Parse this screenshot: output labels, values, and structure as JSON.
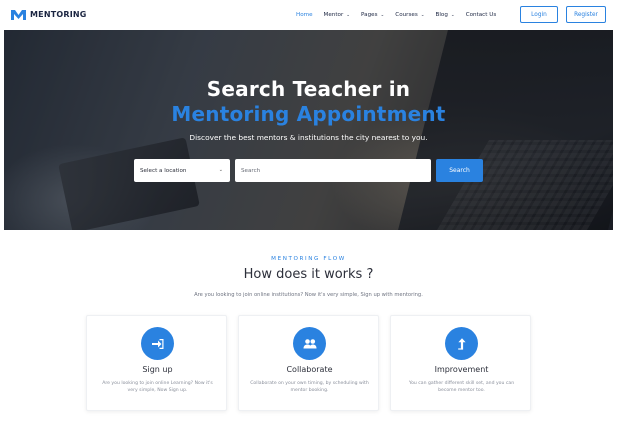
{
  "header": {
    "logo_text": "MENTORING",
    "nav": [
      {
        "label": "Home",
        "active": true,
        "dropdown": false
      },
      {
        "label": "Mentor",
        "active": false,
        "dropdown": true
      },
      {
        "label": "Pages",
        "active": false,
        "dropdown": true
      },
      {
        "label": "Courses",
        "active": false,
        "dropdown": true
      },
      {
        "label": "Blog",
        "active": false,
        "dropdown": true
      },
      {
        "label": "Contact Us",
        "active": false,
        "dropdown": false
      }
    ],
    "login_label": "Login",
    "register_label": "Register"
  },
  "hero": {
    "title": "Search Teacher in",
    "subtitle": "Mentoring Appointment",
    "description": "Discover the best mentors & institutions the city nearest to you.",
    "location_select": "Select a location",
    "search_placeholder": "Search",
    "search_button": "Search"
  },
  "flow": {
    "eyebrow": "MENTORING FLOW",
    "title": "How does it works ?",
    "description": "Are you looking to join online institutions? Now it's very simple, Sign up with mentoring.",
    "cards": [
      {
        "icon": "sign-in-icon",
        "title": "Sign up",
        "text": "Are you looking to join online Learning? Now it's very simple, Now Sign up."
      },
      {
        "icon": "users-icon",
        "title": "Collaborate",
        "text": "Collaborate on your own timing, by scheduling with mentor booking."
      },
      {
        "icon": "arrow-up-icon",
        "title": "Improvement",
        "text": "You can gather different skill set, and you can become mentor too."
      }
    ]
  },
  "colors": {
    "accent": "#2a82e0",
    "brand_dark": "#1b2541",
    "text": "#2c2f3a",
    "muted": "#8a8f9b"
  }
}
